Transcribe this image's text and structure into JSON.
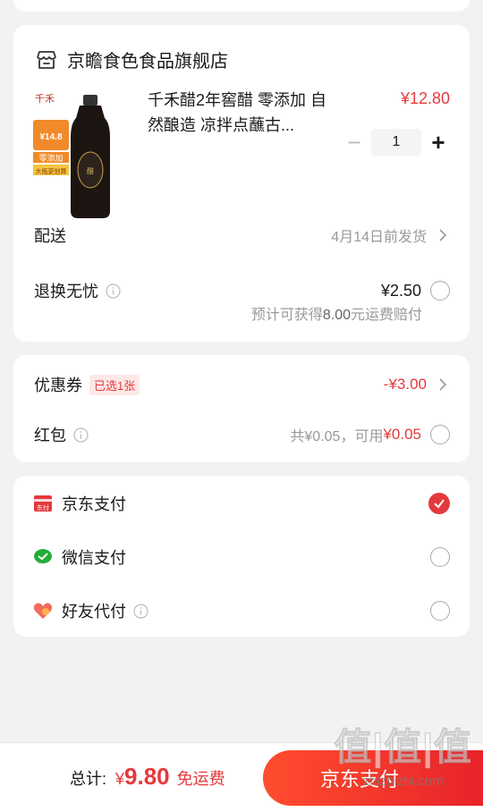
{
  "store": {
    "name": "京瞻食色食品旗舰店",
    "product": {
      "title": "千禾醋2年窖醋 零添加 自然酿造 凉拌点蘸古...",
      "price": "¥12.80",
      "quantity": "1",
      "image": {
        "logo_text": "千禾",
        "price_tag": "¥14.8",
        "badge1": "零添加",
        "badge2": "大瓶更划算"
      }
    },
    "delivery": {
      "label": "配送",
      "value": "4月14日前发货"
    },
    "return": {
      "label": "退换无忧",
      "price": "¥2.50",
      "note_prefix": "预计可获得",
      "note_amount": "8.00",
      "note_suffix": "元运费赔付"
    }
  },
  "discounts": {
    "coupon": {
      "label": "优惠券",
      "badge": "已选1张",
      "value": "-¥3.00"
    },
    "redpacket": {
      "label": "红包",
      "total": "共¥0.05，可用",
      "available": "¥0.05"
    }
  },
  "payments": [
    {
      "label": "京东支付",
      "selected": true,
      "icon": "jd-pay-icon"
    },
    {
      "label": "微信支付",
      "selected": false,
      "icon": "wechat-pay-icon"
    },
    {
      "label": "好友代付",
      "selected": false,
      "icon": "friend-pay-icon"
    }
  ],
  "footer": {
    "total_label": "总计:",
    "currency": "¥",
    "total": "9.80",
    "shipping": "免运费",
    "pay_button": "京东支付"
  },
  "watermark": {
    "main": "值|值|值",
    "url": "zhizhizhi.com"
  },
  "colors": {
    "accent": "#e4393c",
    "button_start": "#ff4d2e",
    "button_end": "#e8232a"
  }
}
